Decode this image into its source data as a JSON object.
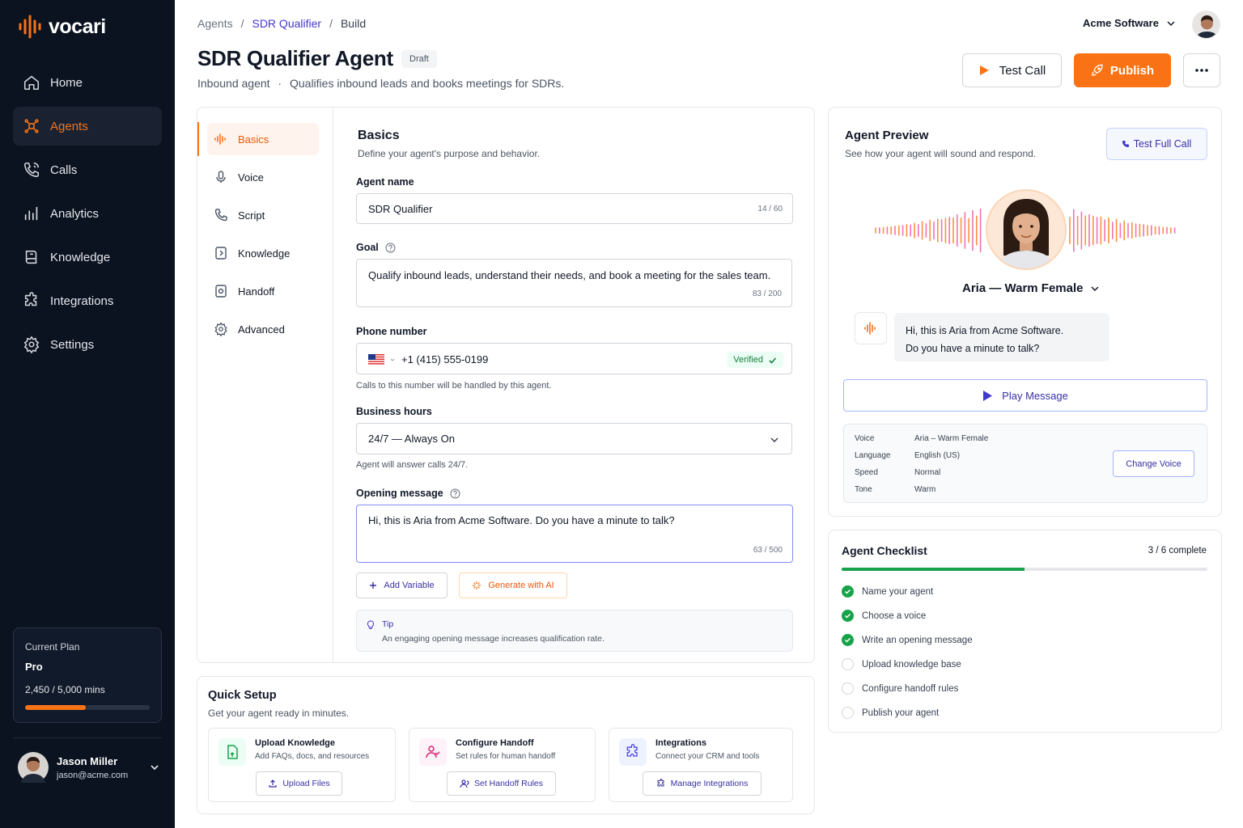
{
  "app": {
    "name": "vocari"
  },
  "sidebar": {
    "items": [
      {
        "label": "Home",
        "icon": "home-icon"
      },
      {
        "label": "Agents",
        "icon": "agents-icon",
        "active": true
      },
      {
        "label": "Calls",
        "icon": "phone-icon"
      },
      {
        "label": "Analytics",
        "icon": "analytics-icon"
      },
      {
        "label": "Knowledge",
        "icon": "book-icon"
      },
      {
        "label": "Integrations",
        "icon": "puzzle-icon"
      },
      {
        "label": "Settings",
        "icon": "gear-icon"
      }
    ],
    "plan": {
      "label": "Current Plan",
      "name": "Pro",
      "usage": "2,450 / 5,000 mins",
      "progress": 0.49
    },
    "user": {
      "name": "Jason Miller",
      "email": "jason@acme.com"
    }
  },
  "header": {
    "breadcrumb": [
      "Agents",
      "SDR Qualifier",
      "Build"
    ],
    "company": "Acme Software",
    "title": "SDR Qualifier Agent",
    "status": "Draft",
    "subtitle_type": "Inbound agent",
    "subtitle_desc": "Qualifies inbound leads and books meetings for SDRs.",
    "test_call": "Test Call",
    "publish": "Publish"
  },
  "subnav": {
    "items": [
      {
        "label": "Basics",
        "icon": "waveform-icon",
        "active": true
      },
      {
        "label": "Voice",
        "icon": "microphone-icon"
      },
      {
        "label": "Script",
        "icon": "phone-script-icon"
      },
      {
        "label": "Knowledge",
        "icon": "document-icon"
      },
      {
        "label": "Handoff",
        "icon": "handoff-icon"
      },
      {
        "label": "Advanced",
        "icon": "gear-icon"
      }
    ]
  },
  "basics": {
    "title": "Basics",
    "desc": "Define your agent's purpose and behavior.",
    "agent_name": {
      "label": "Agent name",
      "value": "SDR Qualifier",
      "counter": "14 / 60"
    },
    "goal": {
      "label": "Goal",
      "value": "Qualify inbound leads, understand their needs, and book a meeting for the sales team.",
      "counter": "83 / 200"
    },
    "phone": {
      "label": "Phone number",
      "value": "+1 (415) 555-0199",
      "verified": "Verified",
      "hint": "Calls to this number will be handled by this agent."
    },
    "hours": {
      "label": "Business hours",
      "value": "24/7 — Always On",
      "hint": "Agent will answer calls 24/7."
    },
    "opening": {
      "label": "Opening message",
      "value": "Hi, this is Aria from Acme Software. Do you have a minute to talk?",
      "counter": "63 / 500"
    },
    "add_variable": "Add Variable",
    "generate_ai": "Generate with AI",
    "tip": {
      "title": "Tip",
      "text": "An engaging opening message increases qualification rate."
    }
  },
  "quick_setup": {
    "title": "Quick Setup",
    "desc": "Get your agent ready in minutes.",
    "items": [
      {
        "title": "Upload Knowledge",
        "desc": "Add FAQs, docs, and resources",
        "button": "Upload Files"
      },
      {
        "title": "Configure Handoff",
        "desc": "Set rules for human handoff",
        "button": "Set Handoff Rules"
      },
      {
        "title": "Integrations",
        "desc": "Connect your CRM and tools",
        "button": "Manage Integrations"
      }
    ]
  },
  "preview": {
    "title": "Agent Preview",
    "desc": "See how your agent will sound and respond.",
    "test_full_call": "Test Full Call",
    "voice_name": "Aria — Warm Female",
    "message_line1": "Hi, this is Aria from Acme Software.",
    "message_line2": "Do you have a minute to talk?",
    "play": "Play Message",
    "settings": [
      {
        "key": "Voice",
        "value": "Aria – Warm Female"
      },
      {
        "key": "Language",
        "value": "English (US)"
      },
      {
        "key": "Speed",
        "value": "Normal"
      },
      {
        "key": "Tone",
        "value": "Warm"
      }
    ],
    "change_voice": "Change Voice"
  },
  "checklist": {
    "title": "Agent Checklist",
    "count": "3 / 6 complete",
    "progress": 0.5,
    "items": [
      {
        "label": "Name your agent",
        "done": true
      },
      {
        "label": "Choose a voice",
        "done": true
      },
      {
        "label": "Write an opening message",
        "done": true
      },
      {
        "label": "Upload knowledge base",
        "done": false
      },
      {
        "label": "Configure handoff rules",
        "done": false
      },
      {
        "label": "Publish your agent",
        "done": false
      }
    ]
  },
  "colors": {
    "accent": "#f97316",
    "sidebar_bg": "#0b1220",
    "link": "#4338ca",
    "success": "#16a34a"
  }
}
